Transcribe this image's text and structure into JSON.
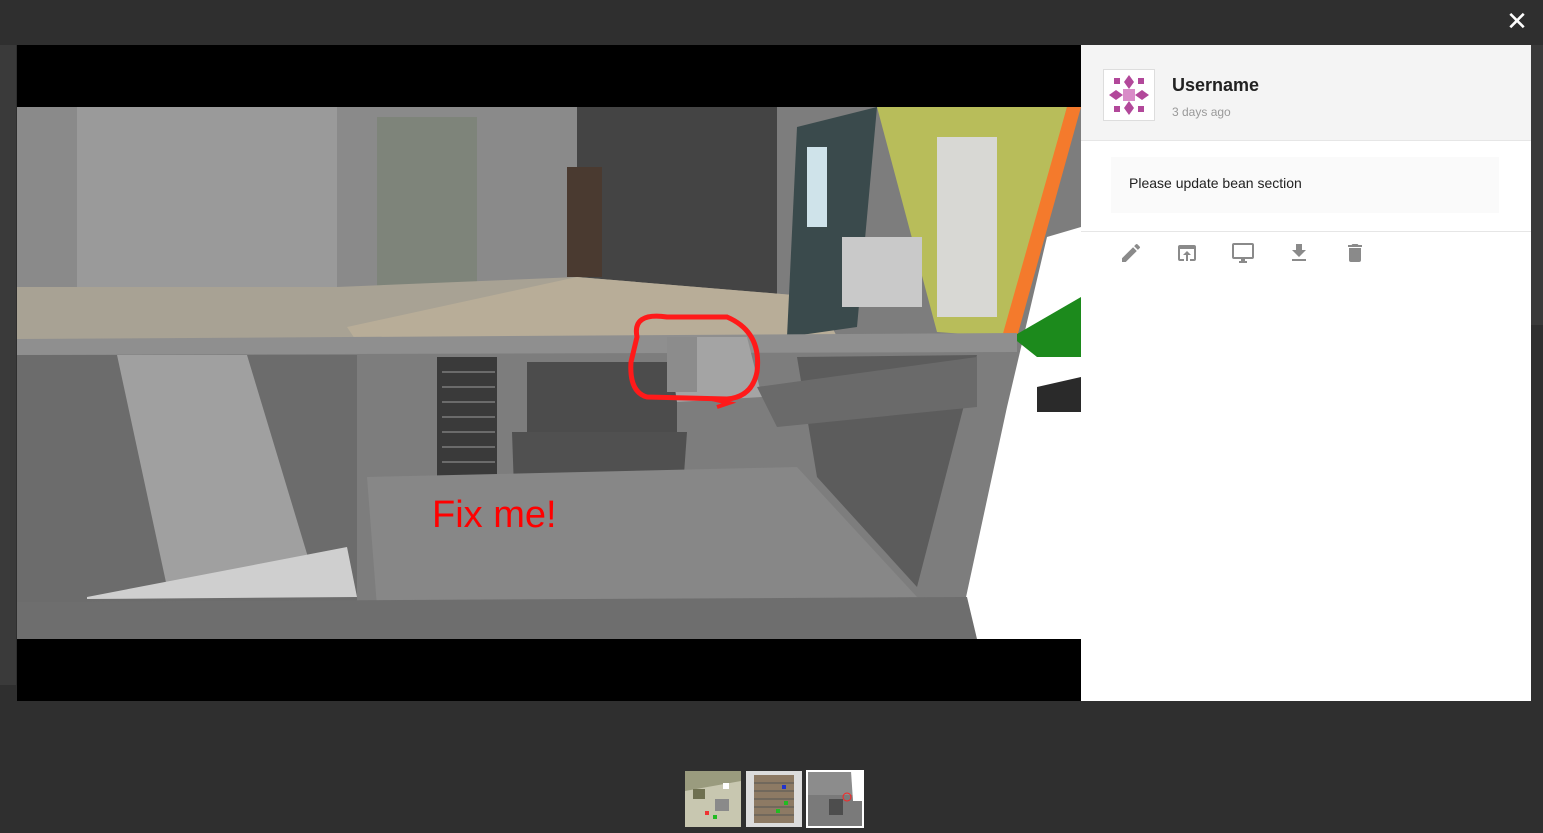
{
  "close_icon": "close-icon",
  "viewer": {
    "annotation_text": "Fix me!"
  },
  "comment": {
    "username": "Username",
    "timestamp": "3 days ago",
    "text": "Please update bean section"
  },
  "toolbar": [
    "edit-icon",
    "open-in-icon",
    "desktop-icon",
    "download-icon",
    "delete-icon"
  ],
  "thumbnails": {
    "count": 3,
    "active_index": 2
  },
  "colors": {
    "annotation": "#ff0000",
    "backdrop": "#2f2f2f",
    "panel_header": "#f4f4f4"
  }
}
